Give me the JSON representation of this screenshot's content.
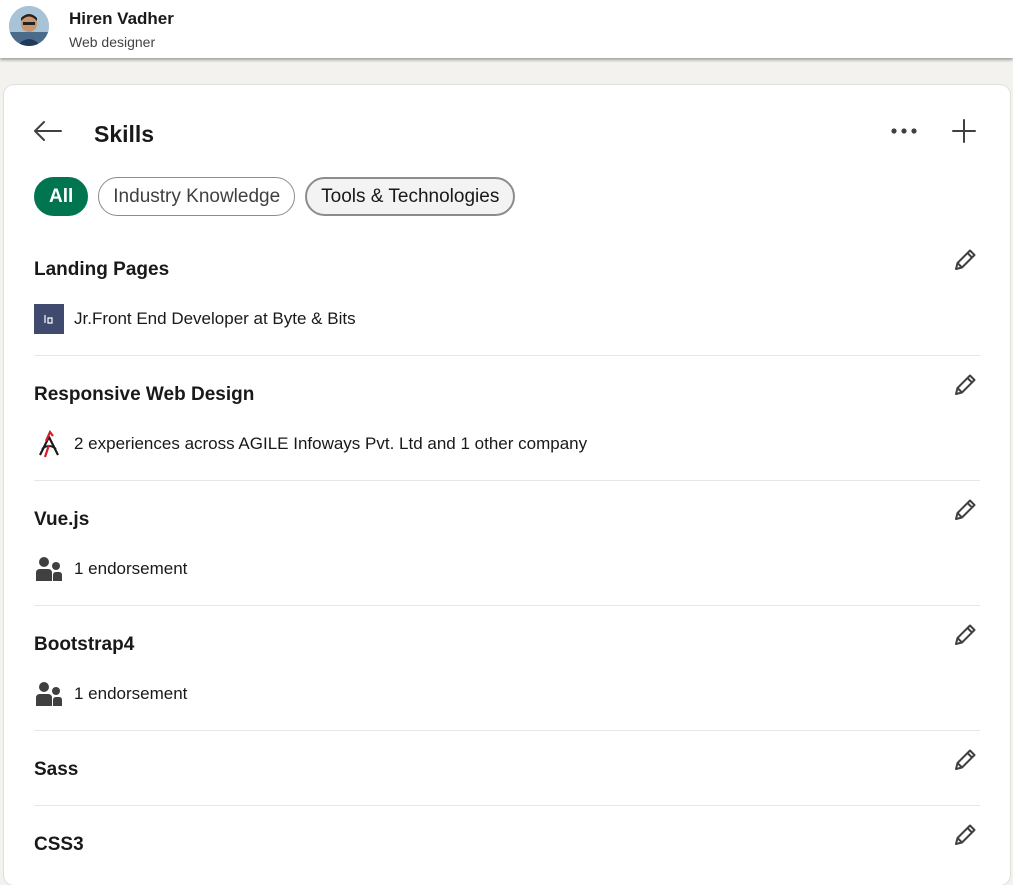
{
  "profile": {
    "name": "Hiren Vadher",
    "headline": "Web designer"
  },
  "page": {
    "title": "Skills"
  },
  "filters": [
    {
      "label": "All",
      "state": "selected"
    },
    {
      "label": "Industry Knowledge",
      "state": "default"
    },
    {
      "label": "Tools & Technologies",
      "state": "hover"
    }
  ],
  "skills": [
    {
      "name": "Landing Pages",
      "detail": "Jr.Front End Developer at Byte & Bits",
      "detail_icon": "company-logo-icon"
    },
    {
      "name": "Responsive Web Design",
      "detail": "2 experiences across AGILE Infoways Pvt. Ltd and 1 other company",
      "detail_icon": "company-logo-icon"
    },
    {
      "name": "Vue.js",
      "detail": "1 endorsement",
      "detail_icon": "people-icon"
    },
    {
      "name": "Bootstrap4",
      "detail": "1 endorsement",
      "detail_icon": "people-icon"
    },
    {
      "name": "Sass"
    },
    {
      "name": "CSS3"
    }
  ],
  "colors": {
    "accent_green": "#01754f",
    "background": "#f4f2ee",
    "card": "#ffffff"
  }
}
